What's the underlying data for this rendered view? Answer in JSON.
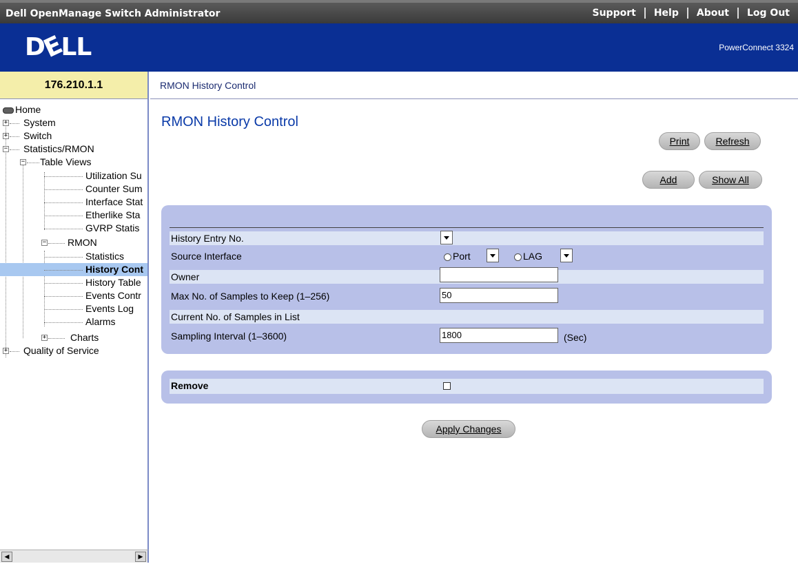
{
  "header": {
    "app_title": "Dell OpenManage Switch Administrator",
    "links": [
      "Support",
      "Help",
      "About",
      "Log Out"
    ],
    "logo_text": "DELL",
    "model": "PowerConnect 3324"
  },
  "left": {
    "ip": "176.210.1.1",
    "tree": {
      "home": "Home",
      "system": "System",
      "switch": "Switch",
      "stats": "Statistics/RMON",
      "table_views": "Table Views",
      "utilization": "Utilization Su",
      "counter": "Counter Sum",
      "interface": "Interface Stat",
      "etherlike": "Etherlike Sta",
      "gvrp": "GVRP Statis",
      "rmon": "RMON",
      "statistics": "Statistics",
      "history_control": "History Cont",
      "history_table": "History Table",
      "events_control": "Events Contr",
      "events_log": "Events Log",
      "alarms": "Alarms",
      "charts": "Charts",
      "qos": "Quality of Service"
    }
  },
  "breadcrumb": "RMON History Control",
  "main": {
    "title": "RMON History Control",
    "buttons": {
      "print": "Print",
      "refresh": "Refresh",
      "add": "Add",
      "show_all": "Show All",
      "apply": "Apply Changes"
    },
    "form": {
      "history_entry_label": "History Entry No.",
      "source_interface_label": "Source Interface",
      "port_label": "Port",
      "lag_label": "LAG",
      "owner_label": "Owner",
      "owner_value": "",
      "max_samples_label": "Max No. of Samples to Keep (1–256)",
      "max_samples_value": "50",
      "current_samples_label": "Current No. of Samples in List",
      "interval_label": "Sampling Interval (1–3600)",
      "interval_value": "1800",
      "interval_unit": "(Sec)"
    },
    "remove_label": "Remove"
  },
  "colors": {
    "banner": "#0a2f94",
    "title": "#0a3aa8",
    "panel": "#b8c0e8",
    "row_light": "#dce4f4",
    "ip_bg": "#f4eeaa"
  }
}
